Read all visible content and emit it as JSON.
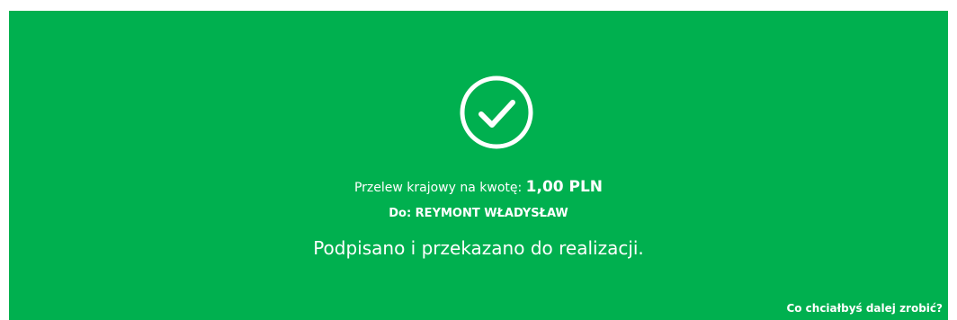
{
  "confirmation": {
    "icon": "check-circle-icon",
    "transfer_label": "Przelew krajowy na kwotę:",
    "amount": "1,00 PLN",
    "recipient_label": "Do:",
    "recipient_name": "REYMONT WŁADYSŁAW",
    "status_message": "Podpisano i przekazano do realizacji."
  },
  "footer": {
    "next_prompt": "Co chciałbyś dalej zrobić?"
  },
  "colors": {
    "panel_background": "#00b04f",
    "text": "#ffffff"
  }
}
